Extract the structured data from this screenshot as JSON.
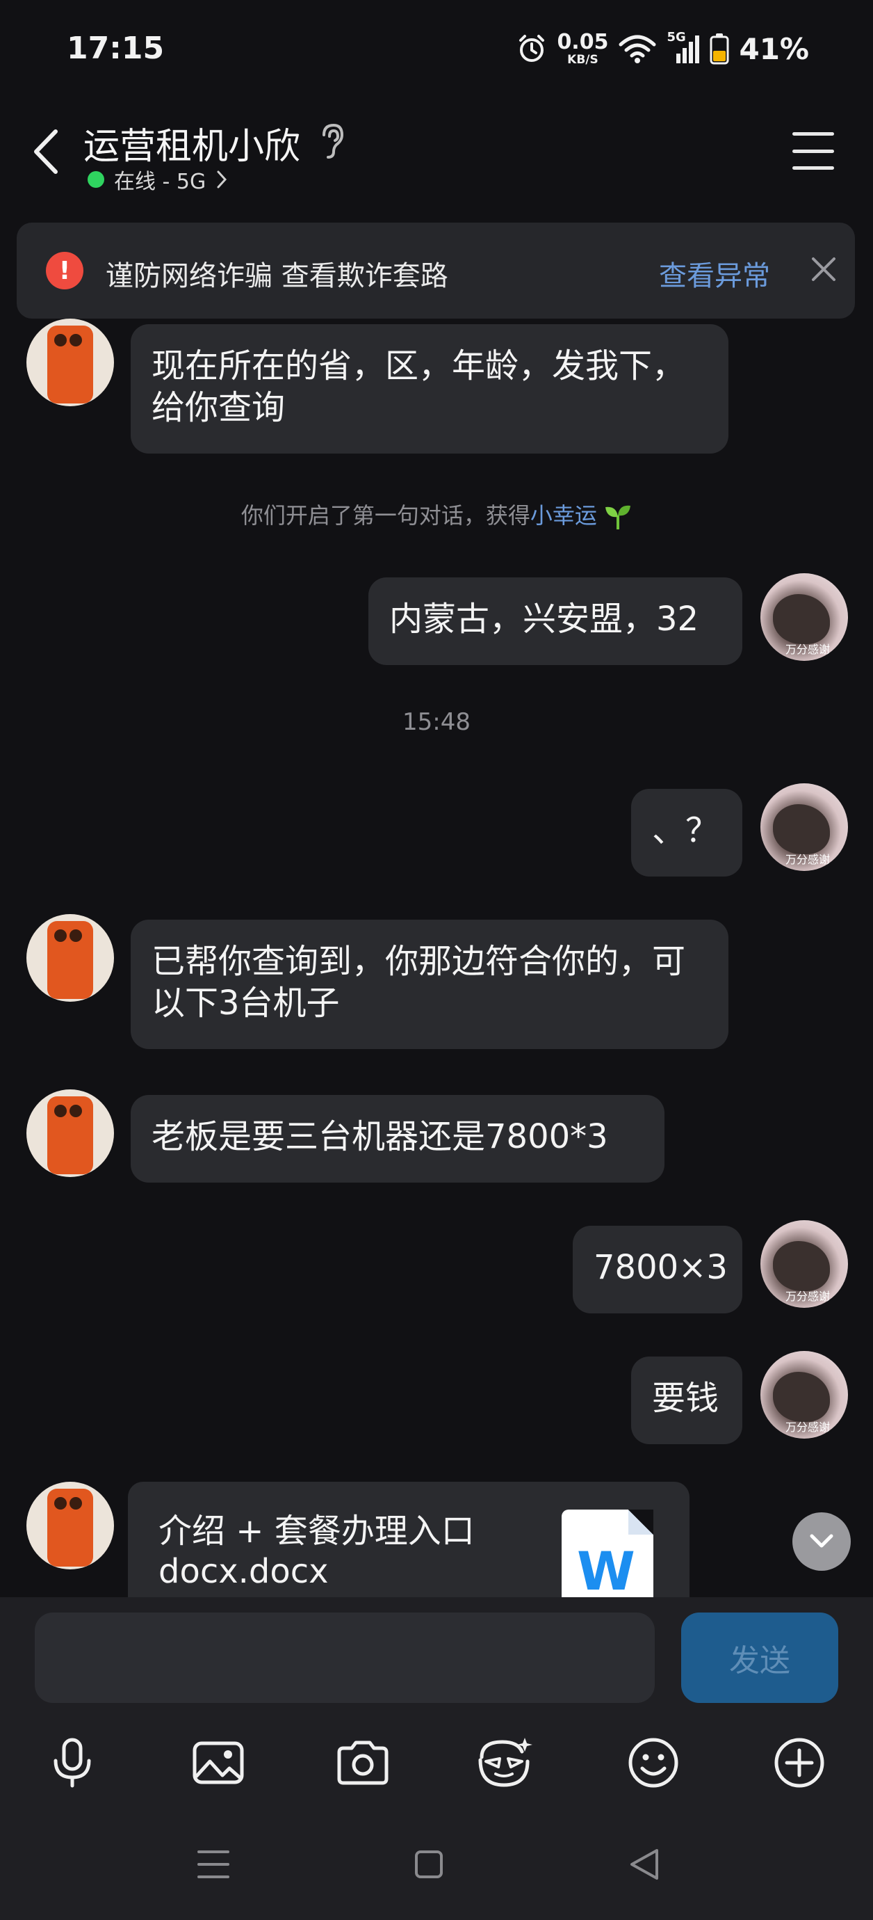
{
  "status_bar": {
    "time": "17:15",
    "net_speed_value": "0.05",
    "net_speed_unit": "KB/S",
    "network_type": "5G",
    "battery_percent": "41%"
  },
  "header": {
    "title": "运营租机小欣",
    "online_status": "在线 - 5G"
  },
  "warning": {
    "text": "谨防网络诈骗 查看欺诈套路",
    "link": "查看异常"
  },
  "messages": [
    {
      "from": "other",
      "text": "现在所在的省，区，年龄，发我下，给你查询"
    },
    {
      "from": "self",
      "text": "内蒙古，兴安盟，32"
    },
    {
      "from": "self",
      "text": "、？"
    },
    {
      "from": "other",
      "text": "已帮你查询到，你那边符合你的，可以下3台机子"
    },
    {
      "from": "other",
      "text": "老板是要三台机器还是7800*3"
    },
    {
      "from": "self",
      "text": "7800×3"
    },
    {
      "from": "self",
      "text": "要钱"
    }
  ],
  "system_note": {
    "prefix": "你们开启了第一句对话，获得",
    "highlight": "小幸运"
  },
  "timestamp": "15:48",
  "self_avatar_caption": "万分感谢",
  "file_message": {
    "name_line1": "介绍 + 套餐办理入口",
    "name_line2": "docx.docx",
    "icon_letter": "W"
  },
  "input": {
    "placeholder": "",
    "send_label": "发送"
  },
  "colors": {
    "background": "#111114",
    "bubble": "#2a2b2f",
    "link": "#6b9bdc",
    "send_button": "#1e5c8e",
    "online": "#2fd35f",
    "warning_icon": "#ef4b3f"
  }
}
